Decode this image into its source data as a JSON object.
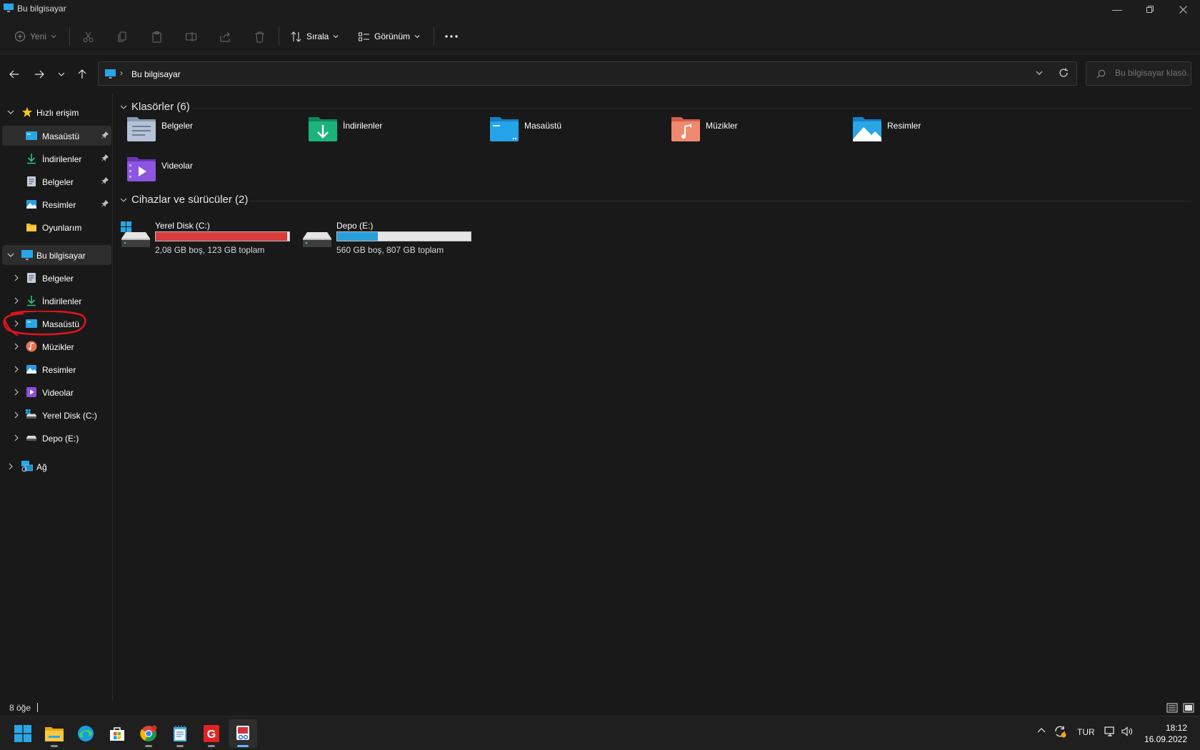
{
  "window": {
    "title": "Bu bilgisayar",
    "controls": [
      "minimize",
      "maximize",
      "close"
    ]
  },
  "commandbar": {
    "new_label": "Yeni",
    "sort_label": "Sırala",
    "view_label": "Görünüm"
  },
  "address": {
    "crumb": "Bu bilgisayar",
    "search_placeholder": "Bu bilgisayar klasö..."
  },
  "nav": {
    "quick_access": "Hızlı erişim",
    "quick_items": [
      {
        "label": "Masaüstü",
        "icon": "desktop-icon",
        "pinned": true
      },
      {
        "label": "İndirilenler",
        "icon": "download-icon",
        "pinned": true
      },
      {
        "label": "Belgeler",
        "icon": "documents-icon",
        "pinned": true
      },
      {
        "label": "Resimler",
        "icon": "pictures-icon",
        "pinned": true
      },
      {
        "label": "Oyunlarım",
        "icon": "folder-icon",
        "pinned": false
      }
    ],
    "this_pc": "Bu bilgisayar",
    "pc_items": [
      {
        "label": "Belgeler",
        "icon": "documents-icon"
      },
      {
        "label": "İndirilenler",
        "icon": "download-icon"
      },
      {
        "label": "Masaüstü",
        "icon": "desktop-icon"
      },
      {
        "label": "Müzikler",
        "icon": "music-icon"
      },
      {
        "label": "Resimler",
        "icon": "pictures-icon"
      },
      {
        "label": "Videolar",
        "icon": "videos-icon"
      },
      {
        "label": "Yerel Disk (C:)",
        "icon": "system-drive-icon"
      },
      {
        "label": "Depo (E:)",
        "icon": "drive-icon"
      }
    ],
    "network": "Ağ"
  },
  "content": {
    "folders_heading": "Klasörler (6)",
    "folders": [
      {
        "label": "Belgeler",
        "icon": "documents-folder-icon"
      },
      {
        "label": "İndirilenler",
        "icon": "downloads-folder-icon"
      },
      {
        "label": "Masaüstü",
        "icon": "desktop-folder-icon"
      },
      {
        "label": "Müzikler",
        "icon": "music-folder-icon"
      },
      {
        "label": "Resimler",
        "icon": "pictures-folder-icon"
      },
      {
        "label": "Videolar",
        "icon": "videos-folder-icon"
      }
    ],
    "devices_heading": "Cihazlar ve sürücüler (2)",
    "drives": [
      {
        "name": "Yerel Disk (C:)",
        "info": "2,08 GB boş, 123 GB toplam",
        "used_fraction": 0.983,
        "bar_color": "#da3b3b"
      },
      {
        "name": "Depo (E:)",
        "info": "560 GB boş, 807 GB toplam",
        "used_fraction": 0.306,
        "bar_color": "#26a0da"
      }
    ]
  },
  "status": {
    "item_count": "8 öğe"
  },
  "taskbar": {
    "apps": [
      "start-icon",
      "file-explorer-icon",
      "edge-icon",
      "store-icon",
      "chrome-icon",
      "notepad-icon",
      "g-app-icon",
      "snipping-tool-icon"
    ],
    "language": "TUR",
    "time": "18:12",
    "date": "16.09.2022"
  },
  "colors": {
    "accent": "#60cdff",
    "annotation": "#e0141e"
  }
}
